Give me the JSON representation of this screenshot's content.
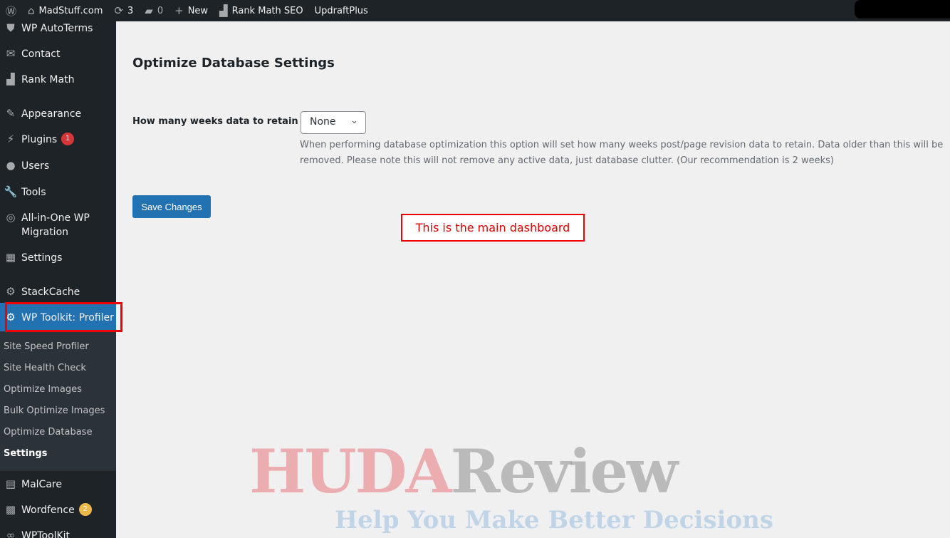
{
  "adminbar": {
    "site": "MadStuff.com",
    "updates": "3",
    "comments": "0",
    "new": "New",
    "rankmath": "Rank Math SEO",
    "updraft": "UpdraftPlus"
  },
  "sidebar": {
    "items": [
      {
        "label": "WP AutoTerms",
        "icon": "shield-icon"
      },
      {
        "label": "Contact",
        "icon": "mail-icon"
      },
      {
        "label": "Rank Math",
        "icon": "chart-icon"
      },
      {
        "label": "Appearance",
        "icon": "brush-icon"
      },
      {
        "label": "Plugins",
        "icon": "plug-icon",
        "badge": "1"
      },
      {
        "label": "Users",
        "icon": "user-icon"
      },
      {
        "label": "Tools",
        "icon": "wrench-icon"
      },
      {
        "label": "All-in-One WP Migration",
        "icon": "migration-icon"
      },
      {
        "label": "Settings",
        "icon": "settings-icon"
      },
      {
        "label": "StackCache",
        "icon": "gear-icon"
      },
      {
        "label": "WP Toolkit: Profiler",
        "icon": "gear-icon"
      },
      {
        "label": "MalCare",
        "icon": "lock-icon"
      },
      {
        "label": "Wordfence",
        "icon": "wordfence-icon",
        "badge": "2"
      },
      {
        "label": "WPToolKit",
        "icon": "link-icon"
      }
    ],
    "submenu": [
      "Site Speed Profiler",
      "Site Health Check",
      "Optimize Images",
      "Bulk Optimize Images",
      "Optimize Database",
      "Settings"
    ]
  },
  "main": {
    "title": "Optimize Database Settings",
    "field_label": "How many weeks data to retain",
    "select_value": "None",
    "description": "When performing database optimization this option will set how many weeks post/page revision data to retain. Data older than this will be removed. Please note this will not remove any active data, just database clutter. (Our recommendation is 2 weeks)",
    "save": "Save Changes"
  },
  "annotation": "This is the main dashboard",
  "watermark": {
    "part1": "HUDA",
    "part2": "Review",
    "tagline": "Help You Make Better Decisions"
  }
}
